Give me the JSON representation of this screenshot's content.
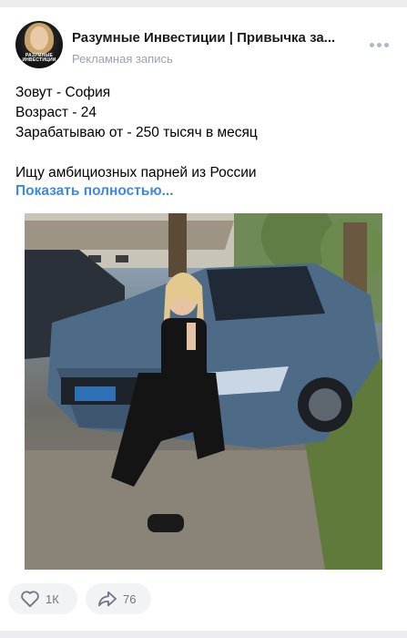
{
  "post": {
    "author": "Разумные Инвестиции | Привычка за...",
    "label": "Рекламная запись",
    "avatar_text": "РАЗУМНЫЕ ИНВЕСТИЦИИ",
    "lines": [
      "Зовут - София",
      "Возраст - 24",
      "Зарабатываю от - 250 тысяч в месяц",
      "",
      "Ищу амбициозных парней из России"
    ],
    "show_more": "Показать полностью..."
  },
  "actions": {
    "likes": "1К",
    "shares": "76"
  },
  "colors": {
    "link": "#3f8ae0",
    "muted": "#99a2ad",
    "pill_bg": "#f2f3f5"
  },
  "icons": [
    "more-icon",
    "heart-icon",
    "share-icon"
  ]
}
